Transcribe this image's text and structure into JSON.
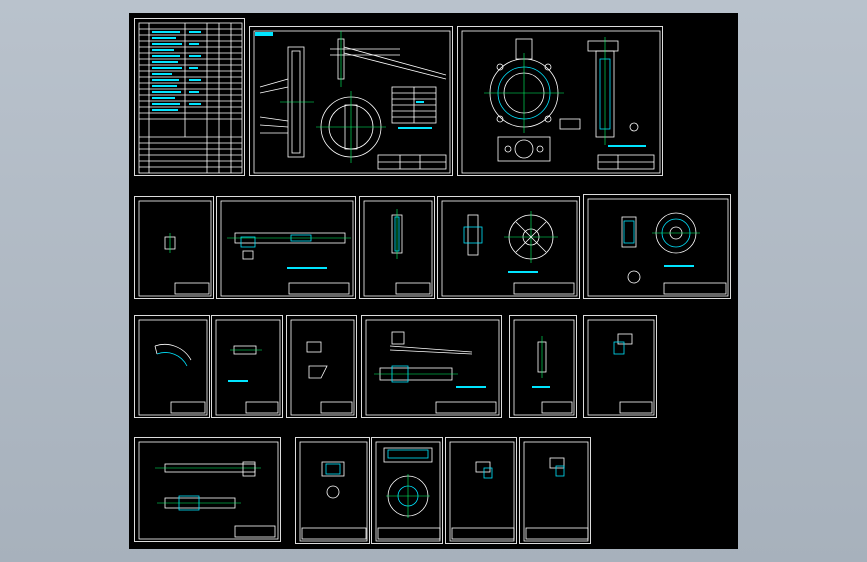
{
  "window": {
    "background": "#b3bcc6",
    "canvas_color": "#000000"
  },
  "colors": {
    "line": "#ffffff",
    "dimension": "#00e5ff",
    "centerline": "#00ff66"
  },
  "sheets": [
    {
      "id": "bom-sheet",
      "label": ""
    },
    {
      "id": "assembly-valve-section",
      "label": ""
    },
    {
      "id": "assembly-valve-front",
      "label": ""
    },
    {
      "id": "part-sheet-r2-1",
      "label": ""
    },
    {
      "id": "part-sheet-r2-2",
      "label": ""
    },
    {
      "id": "part-sheet-r2-3",
      "label": ""
    },
    {
      "id": "part-sheet-r2-4",
      "label": ""
    },
    {
      "id": "part-sheet-r2-5",
      "label": ""
    },
    {
      "id": "part-sheet-r3-1",
      "label": ""
    },
    {
      "id": "part-sheet-r3-2",
      "label": ""
    },
    {
      "id": "part-sheet-r3-3",
      "label": ""
    },
    {
      "id": "part-sheet-r3-4",
      "label": ""
    },
    {
      "id": "part-sheet-r3-5",
      "label": ""
    },
    {
      "id": "part-sheet-r3-6",
      "label": ""
    },
    {
      "id": "part-sheet-r4-1",
      "label": ""
    },
    {
      "id": "part-sheet-r4-2",
      "label": ""
    },
    {
      "id": "part-sheet-r4-3",
      "label": ""
    },
    {
      "id": "part-sheet-r4-4",
      "label": ""
    },
    {
      "id": "part-sheet-r4-5",
      "label": ""
    }
  ]
}
